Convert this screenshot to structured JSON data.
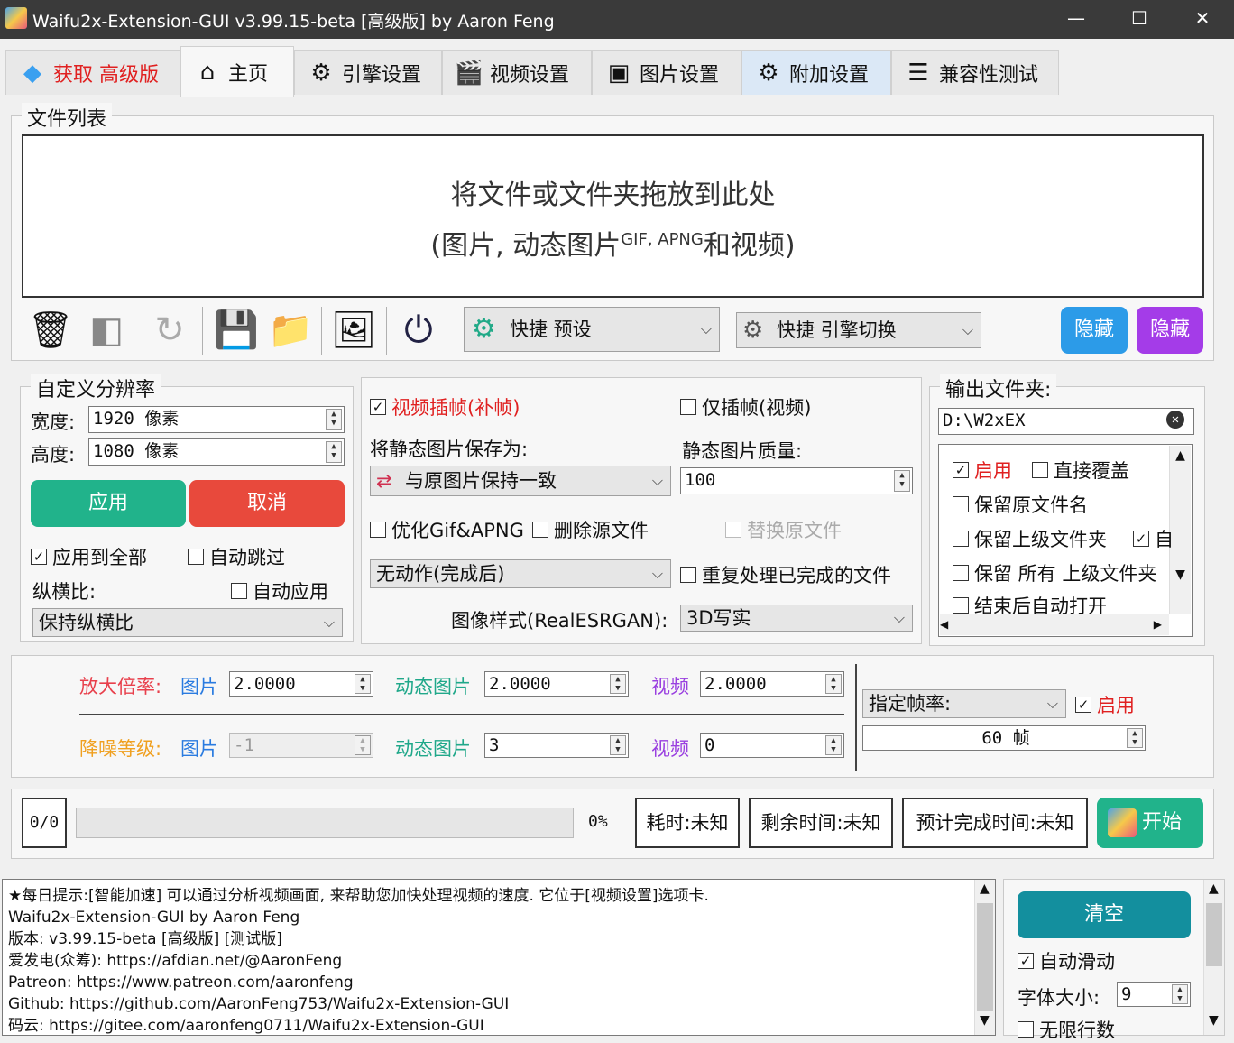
{
  "window": {
    "title": "Waifu2x-Extension-GUI v3.99.15-beta [高级版] by Aaron Feng"
  },
  "tabs": [
    "获取 高级版",
    "主页",
    "引擎设置",
    "视频设置",
    "图片设置",
    "附加设置",
    "兼容性测试"
  ],
  "file_list": {
    "legend": "文件列表",
    "drop_line1": "将文件或文件夹拖放到此处",
    "drop_line2_a": "(图片, 动态图片",
    "drop_line2_sup": "GIF, APNG",
    "drop_line2_b": "和视频)"
  },
  "toolbar": {
    "preset": "快捷 预设",
    "engine_switch": "快捷 引擎切换",
    "hide1": "隐藏",
    "hide2": "隐藏"
  },
  "resolution": {
    "legend": "自定义分辨率",
    "width_label": "宽度:",
    "width_value": "1920 像素",
    "height_label": "高度:",
    "height_value": "1080 像素",
    "apply": "应用",
    "cancel": "取消",
    "apply_all": "应用到全部",
    "auto_skip": "自动跳过",
    "aspect_label": "纵横比:",
    "auto_apply": "自动应用",
    "aspect_value": "保持纵横比"
  },
  "middle": {
    "interp": "视频插帧(补帧)",
    "interp_only": "仅插帧(视频)",
    "save_as_label": "将静态图片保存为:",
    "quality_label": "静态图片质量:",
    "save_as_value": "与原图片保持一致",
    "quality_value": "100",
    "opt_gif": "优化Gif&APNG",
    "del_src": "删除源文件",
    "replace_src": "替换原文件",
    "after_action": "无动作(完成后)",
    "reprocess": "重复处理已完成的文件",
    "style_label": "图像样式(RealESRGAN):",
    "style_value": "3D写实"
  },
  "output": {
    "legend": "输出文件夹:",
    "path": "D:\\W2xEX",
    "enable": "启用",
    "overwrite": "直接覆盖",
    "keep_name": "保留原文件名",
    "keep_parent": "保留上级文件夹",
    "keep_parent_tail": "自",
    "keep_all_parent": "保留 所有 上级文件夹",
    "auto_open": "结束后自动打开"
  },
  "scale": {
    "scale_label": "放大倍率:",
    "image": "图片",
    "gif": "动态图片",
    "video": "视频",
    "scale_img": "2.0000",
    "scale_gif": "2.0000",
    "scale_vid": "2.0000",
    "noise_label": "降噪等级:",
    "noise_img": "-1",
    "noise_gif": "3",
    "noise_vid": "0",
    "fps_dd": "指定帧率:",
    "fps_enable": "启用",
    "fps_value": "60 帧"
  },
  "progress": {
    "count": "0/0",
    "percent": "0%",
    "elapsed": "耗时:未知",
    "remaining": "剩余时间:未知",
    "eta": "预计完成时间:未知",
    "start": "开始",
    "fill": 0
  },
  "log": {
    "lines": [
      "★每日提示:[智能加速] 可以通过分析视频画面, 来帮助您加快处理视频的速度. 它位于[视频设置]选项卡.",
      "Waifu2x-Extension-GUI by Aaron Feng",
      "版本: v3.99.15-beta [高级版] [测试版]",
      "爱发电(众筹): https://afdian.net/@AaronFeng",
      "Patreon: https://www.patreon.com/aaronfeng",
      "Github: https://github.com/AaronFeng753/Waifu2x-Extension-GUI",
      "码云: https://gitee.com/aaronfeng0711/Waifu2x-Extension-GUI"
    ]
  },
  "side": {
    "clear": "清空",
    "auto_scroll": "自动滑动",
    "font_size_label": "字体大小:",
    "font_size": "9",
    "infinite": "无限行数"
  }
}
